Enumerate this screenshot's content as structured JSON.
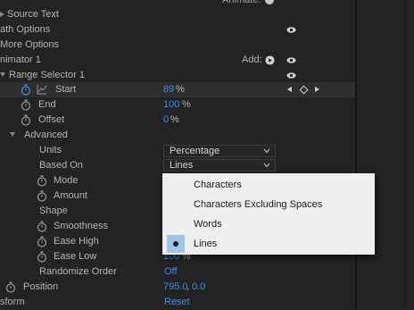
{
  "partial_top_label": "Animate:",
  "rows": {
    "source_text": "Source Text",
    "path_options": "ath Options",
    "more_options": "More Options",
    "animator": "nimator 1",
    "add_label": "Add:",
    "range_selector": "Range Selector 1",
    "start": "Start",
    "start_value": "89",
    "start_unit": "%",
    "end": "End",
    "end_value": "100",
    "end_unit": "%",
    "offset": "Offset",
    "offset_value": "0",
    "offset_unit": "%",
    "advanced": "Advanced",
    "units": "Units",
    "units_value": "Percentage",
    "based_on": "Based On",
    "based_on_value": "Lines",
    "mode": "Mode",
    "amount": "Amount",
    "shape": "Shape",
    "smoothness": "Smoothness",
    "ease_high": "Ease High",
    "ease_low": "Ease Low",
    "ease_low_value": "100",
    "ease_low_unit": "%",
    "randomize_order": "Randomize Order",
    "randomize_value": "Off",
    "position": "Position",
    "position_x": "795.0",
    "position_sep": ",",
    "position_y": "0.0",
    "transform": "sform",
    "reset": "Reset"
  },
  "dropdown_menu": {
    "items": [
      "Characters",
      "Characters Excluding Spaces",
      "Words",
      "Lines"
    ],
    "selected_index": 3
  },
  "colors": {
    "background": "#232323",
    "value_blue": "#3d8ee8",
    "menu_bg": "#eeeeee",
    "menu_selected": "#9cc4ea"
  }
}
